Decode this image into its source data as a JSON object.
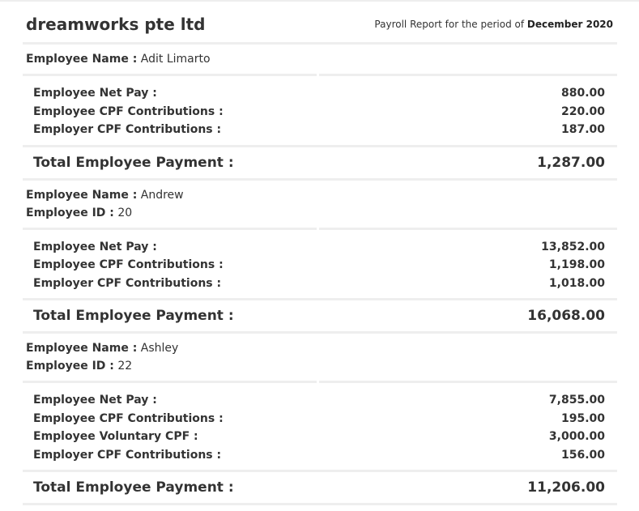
{
  "company": "dreamworks pte ltd",
  "period_prefix": "Payroll Report for the period of",
  "period": "December 2020",
  "labels": {
    "employee_name": "Employee Name :",
    "employee_id": "Employee ID :",
    "total": "Total Employee Payment :"
  },
  "employees": [
    {
      "name": "Adit Limarto",
      "rows": [
        {
          "label": "Employee Net Pay :",
          "value": "880.00"
        },
        {
          "label": "Employee CPF Contributions :",
          "value": "220.00"
        },
        {
          "label": "Employer CPF Contributions :",
          "value": "187.00"
        }
      ],
      "total": "1,287.00"
    },
    {
      "name": "Andrew",
      "id": "20",
      "rows": [
        {
          "label": "Employee Net Pay :",
          "value": "13,852.00"
        },
        {
          "label": "Employee CPF Contributions :",
          "value": "1,198.00"
        },
        {
          "label": "Employer CPF Contributions :",
          "value": "1,018.00"
        }
      ],
      "total": "16,068.00"
    },
    {
      "name": "Ashley",
      "id": "22",
      "rows": [
        {
          "label": "Employee Net Pay :",
          "value": "7,855.00"
        },
        {
          "label": "Employee CPF Contributions :",
          "value": "195.00"
        },
        {
          "label": "Employee Voluntary CPF :",
          "value": "3,000.00"
        },
        {
          "label": "Employer CPF Contributions :",
          "value": "156.00"
        }
      ],
      "total": "11,206.00"
    }
  ]
}
